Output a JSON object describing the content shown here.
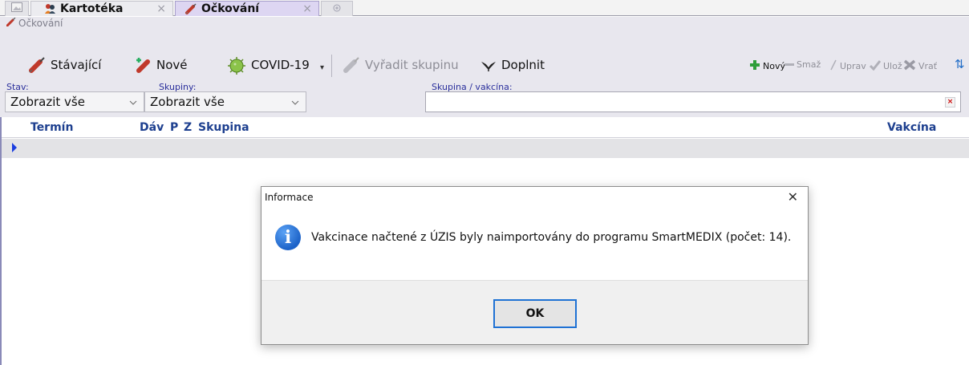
{
  "tabs": [
    {
      "label": "",
      "icon": "image-icon"
    },
    {
      "label": "Kartotéka",
      "icon": "users-icon",
      "close": "×"
    },
    {
      "label": "Očkování",
      "icon": "syringe-icon",
      "close": "×",
      "active": true
    },
    {
      "label": "",
      "icon": "add-tab-icon"
    }
  ],
  "module": {
    "title": "Očkování"
  },
  "toolbar": {
    "stavajici": "Stávající",
    "nove": "Nové",
    "covid": "COVID-19",
    "dropdown_arrow": "▾",
    "vyradit": "Vyřadit skupinu",
    "doplnit": "Doplnit",
    "novy": "Nový",
    "smaz": "Smaž",
    "uprav": "Uprav",
    "uloz": "Ulož",
    "vrat": "Vrať",
    "refresh": "⇅"
  },
  "filters": {
    "stav_label": "Stav:",
    "stav_value": "Zobrazit vše",
    "skupiny_label": "Skupiny:",
    "skupiny_value": "Zobrazit vše",
    "search_label": "Skupina / vakcína:",
    "search_value": "",
    "clear": "×"
  },
  "grid": {
    "columns": [
      "Termín",
      "Dávka",
      "P",
      "Z",
      "Skupina",
      "Vakcína"
    ]
  },
  "dialog": {
    "title": "Informace",
    "close": "✕",
    "icon": "i",
    "message": "Vakcinace načtené z ÚZIS byly naimportovány do programu SmartMEDIX (počet: 14).",
    "ok": "OK"
  },
  "colors": {
    "accent": "#1f72d4",
    "tab_active": "#ddd6f2",
    "header_text": "#1d3f8f",
    "label_text": "#2a2f9c"
  }
}
